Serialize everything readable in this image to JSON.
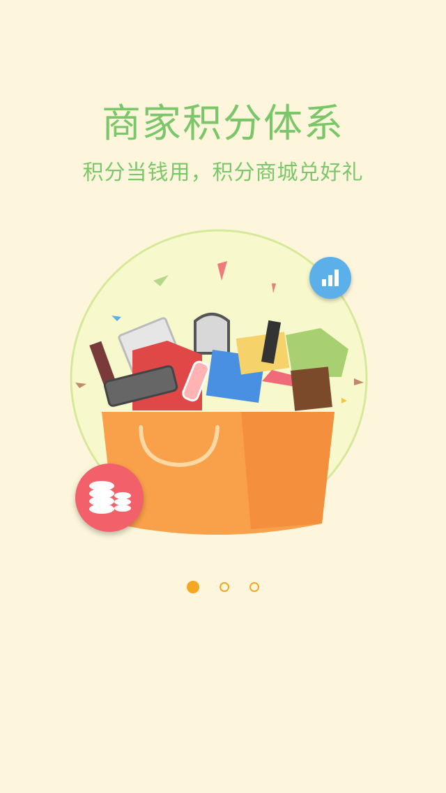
{
  "onboarding": {
    "title": "商家积分体系",
    "subtitle": "积分当钱用，积分商城兑好礼",
    "illustration_icon": "shopping-basket-with-goods",
    "badges": {
      "stats_icon": "bar-chart-icon",
      "coins_icon": "coins-stack-icon"
    },
    "pager": {
      "total": 3,
      "current": 1
    }
  },
  "colors": {
    "background": "#fdf6dc",
    "accent_green": "#7cc66a",
    "accent_orange": "#f5a623",
    "circle_bg": "#f7f9cc",
    "badge_blue": "#5cb0ea",
    "badge_red": "#f2606a"
  }
}
